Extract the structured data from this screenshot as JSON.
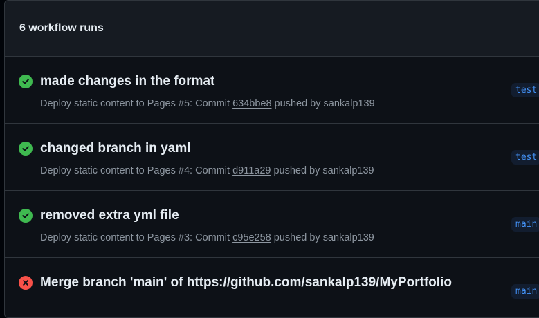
{
  "header": {
    "title": "6 workflow runs"
  },
  "colors": {
    "success": "#3fb950",
    "failure": "#f85149",
    "accent": "#4493f8"
  },
  "runs": [
    {
      "status": "success",
      "status_icon": "check-circle-icon",
      "title": "made changes in the format",
      "workflow": "Deploy static content to Pages",
      "run_number": "#5",
      "commit_prefix": ": Commit ",
      "commit": "634bbe8",
      "pushed_by": " pushed by sankalp139",
      "branch": "test"
    },
    {
      "status": "success",
      "status_icon": "check-circle-icon",
      "title": "changed branch in yaml",
      "workflow": "Deploy static content to Pages",
      "run_number": "#4",
      "commit_prefix": ": Commit ",
      "commit": "d911a29",
      "pushed_by": " pushed by sankalp139",
      "branch": "test"
    },
    {
      "status": "success",
      "status_icon": "check-circle-icon",
      "title": "removed extra yml file",
      "workflow": "Deploy static content to Pages",
      "run_number": "#3",
      "commit_prefix": ": Commit ",
      "commit": "c95e258",
      "pushed_by": " pushed by sankalp139",
      "branch": "main"
    },
    {
      "status": "failure",
      "status_icon": "x-circle-icon",
      "title": "Merge branch 'main' of https://github.com/sankalp139/MyPortfolio",
      "branch": "main"
    }
  ]
}
